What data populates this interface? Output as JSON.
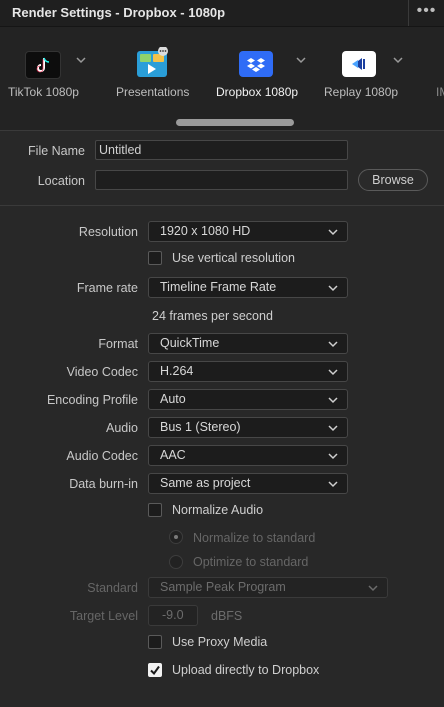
{
  "header": {
    "title": "Render Settings - Dropbox - 1080p"
  },
  "presets": [
    {
      "label": "TikTok 1080p",
      "icon": "tiktok-icon"
    },
    {
      "label": "Presentations",
      "icon": "presentations-icon"
    },
    {
      "label": "Dropbox 1080p",
      "icon": "dropbox-icon",
      "active": true
    },
    {
      "label": "Replay 1080p",
      "icon": "replay-icon"
    },
    {
      "label": "IM",
      "icon": "partial-preset-label"
    }
  ],
  "file": {
    "name_label": "File Name",
    "name_value": "Untitled",
    "location_label": "Location",
    "location_value": "",
    "browse_label": "Browse"
  },
  "settings": {
    "resolution_label": "Resolution",
    "resolution_value": "1920 x 1080 HD",
    "vertical_label": "Use vertical resolution",
    "framerate_label": "Frame rate",
    "framerate_value": "Timeline Frame Rate",
    "framerate_info": "24 frames per second",
    "format_label": "Format",
    "format_value": "QuickTime",
    "videocodec_label": "Video Codec",
    "videocodec_value": "H.264",
    "encoding_label": "Encoding Profile",
    "encoding_value": "Auto",
    "audio_label": "Audio",
    "audio_value": "Bus 1 (Stereo)",
    "audiocodec_label": "Audio Codec",
    "audiocodec_value": "AAC",
    "burnin_label": "Data burn-in",
    "burnin_value": "Same as project",
    "normalize_label": "Normalize Audio",
    "normalize_radio": "Normalize to standard",
    "optimize_radio": "Optimize to standard",
    "standard_label": "Standard",
    "standard_value": "Sample Peak Program",
    "level_label": "Target Level",
    "level_value": "-9.0",
    "level_unit": "dBFS",
    "proxy_label": "Use Proxy Media",
    "upload_label": "Upload directly to Dropbox"
  },
  "colors": {
    "accent": "#2f6cf6",
    "background": "#282828"
  }
}
